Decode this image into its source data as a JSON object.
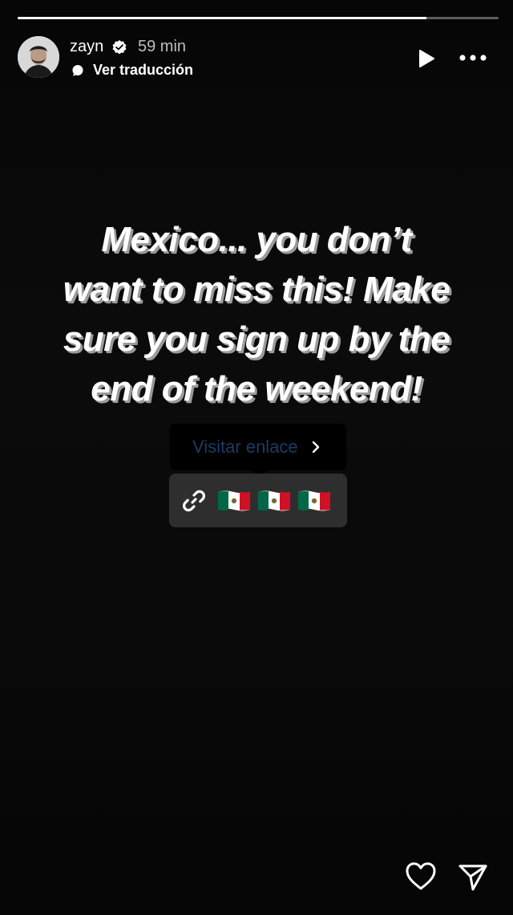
{
  "story": {
    "progress": 0.85,
    "username": "zayn",
    "verified": true,
    "time": "59 min",
    "translate_label": "Ver traducción"
  },
  "content": {
    "headline_lines": [
      "Mexico... you don’t",
      "want to miss this! Make",
      "sure you sign up by the",
      "end of the weekend!"
    ]
  },
  "link_sticker": {
    "visit_label": "Visitar enlace",
    "flags": [
      "mexico-flag",
      "mexico-flag",
      "mexico-flag"
    ]
  },
  "icons": {
    "play": "play-icon",
    "more": "more-icon",
    "like": "heart-icon",
    "share": "send-icon",
    "link": "link-icon"
  },
  "colors": {
    "link_text": "#1c3a63",
    "sticker_bg": "#2e2e2e",
    "flag_green": "#006847",
    "flag_red": "#ce1126"
  }
}
